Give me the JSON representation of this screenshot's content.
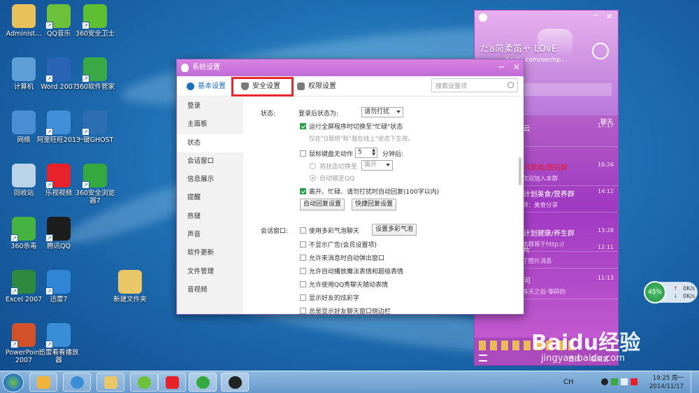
{
  "desktop": {
    "icons": [
      {
        "label": "Administ...",
        "icon": "user-folder-icon",
        "color": "#e9c15b"
      },
      {
        "label": "QQ音乐",
        "icon": "qq-music-icon",
        "color": "#6bc13a"
      },
      {
        "label": "360安全卫士",
        "icon": "360-safe-icon",
        "color": "#5fbf32"
      },
      {
        "label": "计算机",
        "icon": "computer-icon",
        "color": "#5e9fd8"
      },
      {
        "label": "Word 2007",
        "icon": "word-icon",
        "color": "#2b64b7"
      },
      {
        "label": "360软件管家",
        "icon": "360-software-icon",
        "color": "#3aa944"
      },
      {
        "label": "网络",
        "icon": "network-icon",
        "color": "#4a8fd6"
      },
      {
        "label": "阿里旺旺2013",
        "icon": "aliwangwang-icon",
        "color": "#3f8fd9"
      },
      {
        "label": "一键GHOST",
        "icon": "ghost-icon",
        "color": "#2e6fb3"
      },
      {
        "label": "回收站",
        "icon": "recycle-bin-icon",
        "color": "#b9d3e8"
      },
      {
        "label": "乐视视频",
        "icon": "letv-icon",
        "color": "#e8222a"
      },
      {
        "label": "360安全浏览器7",
        "icon": "360-browser-icon",
        "color": "#35a93f"
      },
      {
        "label": "360杀毒",
        "icon": "360-antivirus-icon",
        "color": "#46b23f"
      },
      {
        "label": "腾讯QQ",
        "icon": "qq-icon",
        "color": "#1d1d1d"
      },
      {
        "label": "Excel 2007",
        "icon": "excel-icon",
        "color": "#2c8b3d"
      },
      {
        "label": "迅雷7",
        "icon": "thunder-icon",
        "color": "#2f86d6"
      },
      {
        "label": "新建文件夹",
        "icon": "folder-icon",
        "color": "#e9c667"
      },
      {
        "label": "PowerPoint 2007",
        "icon": "powerpoint-icon",
        "color": "#d2532a"
      },
      {
        "label": "迅雷看看播放器",
        "icon": "xunlei-player-icon",
        "color": "#3a8ed8"
      }
    ]
  },
  "qq_panel": {
    "nickname": "だa简柔笛ャ LOvE",
    "signature": "...baidu.com/ser/np...",
    "weather": "聊天",
    "items": [
      {
        "title": "...云",
        "time": "17:17",
        "subtitle": ""
      },
      {
        "title": "...时游戏/数码群",
        "time": "16:26",
        "subtitle": "...欢迎加入本群"
      },
      {
        "title": "...计划美食/营养群",
        "time": "14:12",
        "subtitle": "...群：美食分享"
      },
      {
        "title": "...计划健康/养生群",
        "time": "13:28",
        "subtitle": "...本群将于http://"
      },
      {
        "title": "...片",
        "time": "12:11",
        "subtitle": "...了图片消息"
      },
      {
        "title": "...问",
        "time": "11:13",
        "subtitle": "...春天之后·零碎的"
      }
    ],
    "bottom_labels": [
      "查找",
      "应用宝"
    ]
  },
  "dialog": {
    "title": "系统设置",
    "tabs": [
      {
        "label": "基本设置",
        "icon": "gear-icon"
      },
      {
        "label": "安全设置",
        "icon": "shield-icon"
      },
      {
        "label": "权限设置",
        "icon": "lock-icon"
      }
    ],
    "search_placeholder": "搜索设置项",
    "sidebar": [
      "登录",
      "主面板",
      "状态",
      "会话窗口",
      "信息展示",
      "提醒",
      "热键",
      "声音",
      "软件更新",
      "文件管理",
      "音视频"
    ],
    "status": {
      "section_label": "状态:",
      "after_login_label": "登录后状态为:",
      "after_login_value": "请勿打扰",
      "busy_switch": "运行全屏程序时切换至\"忙碌\"状态",
      "busy_hint": "仅在\"Q我吧\"和\"我在线上\"状态下生效。",
      "idle_label": "鼠标键盘无动作",
      "idle_minutes": "5",
      "idle_unit": "分钟后:",
      "switch_to_label": "将状态切换至",
      "switch_to_value": "离开",
      "auto_lock": "自动锁定QQ",
      "auto_reply": "离开、忙碌、请勿打扰时自动回复(100字以内)",
      "auto_reply_btn": "自动回复设置",
      "quick_reply_btn": "快捷回复设置"
    },
    "session": {
      "section_label": "会话窗口:",
      "bubble": "使用多彩气泡聊天",
      "bubble_btn": "设置多彩气泡",
      "options": [
        "不显示广告(会员设置项)",
        "允许来消息时自动弹出窗口",
        "允许自动播放魔法表情和超级表情",
        "允许使用QQ秀聊天随动表情",
        "显示好友的炫彩字",
        "总是显示好友聊天窗口侧边栏"
      ]
    }
  },
  "network_widget": {
    "percent": "45%",
    "up": "0K/s",
    "down": "0K/s"
  },
  "taskbar": {
    "clock_time": "19:25 周一",
    "clock_date": "2014/11/17",
    "lang": "CH"
  },
  "watermark": {
    "brand": "Baidu经验",
    "url": "jingyan.baidu.com"
  }
}
